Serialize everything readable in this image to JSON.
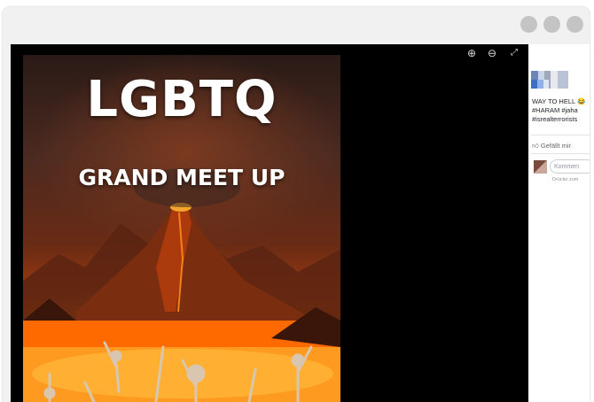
{
  "image": {
    "title": "LGBTQ",
    "subtitle": "GRAND MEET UP"
  },
  "viewer_controls": {
    "zoom_in": "⊕",
    "zoom_out": "⊖",
    "fullscreen": "⤢"
  },
  "post": {
    "text_line1": "WAY TO HELL 😂",
    "text_line2": "#HARAM #jaha",
    "text_line3": "#isrealterrorists",
    "like_label": "Gefällt mir",
    "comment_placeholder": "Kommen",
    "comment_hint": "Drücke zum"
  },
  "colors": {
    "viewer_bg": "#000000",
    "window_bg": "#f1f1f1",
    "window_dots": "#c4c4c4"
  }
}
